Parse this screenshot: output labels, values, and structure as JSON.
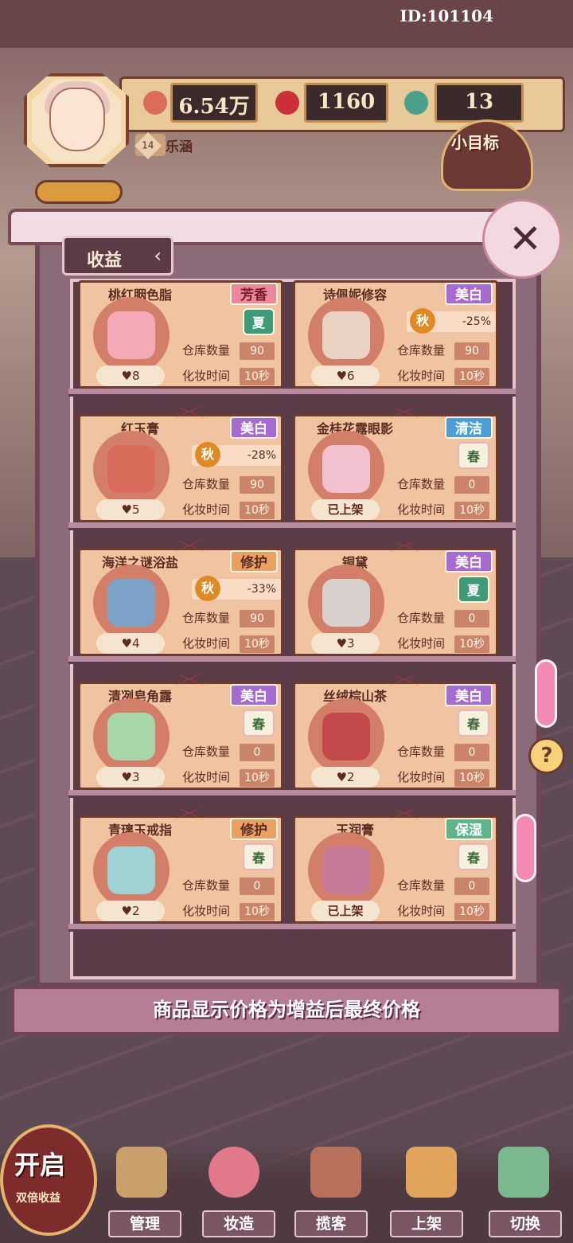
{
  "id_label": "ID:101104",
  "player": {
    "level": "14",
    "name": "乐涵"
  },
  "resources": [
    {
      "value": "6.54万",
      "icon": "coin-icon"
    },
    {
      "value": "1160",
      "icon": "red-gem-icon"
    },
    {
      "value": "13",
      "icon": "token-icon"
    }
  ],
  "goal_label": "小目标",
  "panel": {
    "tab_label": "收益",
    "footer_note": "商品显示价格为增益后最终价格"
  },
  "cards": [
    {
      "name": "桃红胭色脂",
      "tag": "芳香",
      "season": "夏",
      "stock_label": "仓库数量",
      "stock": "90",
      "time_label": "化妆时间",
      "time": "10秒",
      "price": "8"
    },
    {
      "name": "诗佩妮修容",
      "tag": "美白",
      "season": "秋",
      "bonus": "-25%",
      "stock_label": "仓库数量",
      "stock": "90",
      "time_label": "化妆时间",
      "time": "10秒",
      "price": "6"
    },
    {
      "name": "红玉膏",
      "tag": "美白",
      "season": "秋",
      "bonus": "-28%",
      "stock_label": "仓库数量",
      "stock": "90",
      "time_label": "化妆时间",
      "time": "10秒",
      "price": "5"
    },
    {
      "name": "金桂花露眼影",
      "tag": "清洁",
      "season": "春",
      "stock_label": "仓库数量",
      "stock": "0",
      "time_label": "化妆时间",
      "time": "10秒",
      "status": "已上架"
    },
    {
      "name": "海洋之谜浴盐",
      "tag": "修护",
      "season": "秋",
      "bonus": "-33%",
      "stock_label": "仓库数量",
      "stock": "90",
      "time_label": "化妆时间",
      "time": "10秒",
      "price": "4"
    },
    {
      "name": "铜黛",
      "tag": "美白",
      "season": "夏",
      "stock_label": "仓库数量",
      "stock": "0",
      "time_label": "化妆时间",
      "time": "10秒",
      "price": "3"
    },
    {
      "name": "清冽皂角露",
      "tag": "美白",
      "season": "春",
      "stock_label": "仓库数量",
      "stock": "0",
      "time_label": "化妆时间",
      "time": "10秒",
      "price": "3"
    },
    {
      "name": "丝绒棕山茶",
      "tag": "美白",
      "season": "春",
      "stock_label": "仓库数量",
      "stock": "0",
      "time_label": "化妆时间",
      "time": "10秒",
      "price": "2"
    },
    {
      "name": "青璃玉戒指",
      "tag": "修护",
      "season": "春",
      "stock_label": "仓库数量",
      "stock": "0",
      "time_label": "化妆时间",
      "time": "10秒",
      "price": "2"
    },
    {
      "name": "玉润膏",
      "tag": "保湿",
      "season": "春",
      "stock_label": "仓库数量",
      "stock": "0",
      "time_label": "化妆时间",
      "time": "10秒",
      "status": "已上架"
    }
  ],
  "double_income": {
    "line1": "开启",
    "line2": "双倍收益"
  },
  "nav": [
    {
      "label": "管理",
      "icon": "shop-icon"
    },
    {
      "label": "妆造",
      "icon": "makeup-icon"
    },
    {
      "label": "揽客",
      "icon": "signpost-icon"
    },
    {
      "label": "上架",
      "icon": "shelf-icon"
    },
    {
      "label": "切换",
      "icon": "map-icon"
    }
  ]
}
